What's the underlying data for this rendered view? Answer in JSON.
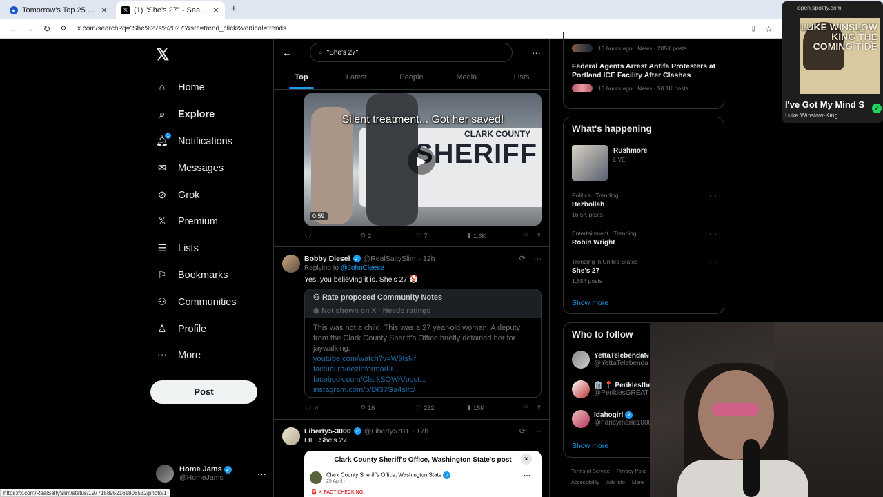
{
  "browser": {
    "tabs": [
      {
        "title": "Tomorrow's Top 25 Today proje",
        "active": false
      },
      {
        "title": "(1) \"She's 27\" - Search / X",
        "active": true
      }
    ],
    "url": "x.com/search?q=\"She%27s%2027\"&src=trend_click&vertical=trends",
    "status_url": "https://x.com/RealSaltySlim/status/1977158952161808532/photo/1"
  },
  "nav": {
    "items": [
      "Home",
      "Explore",
      "Notifications",
      "Messages",
      "Grok",
      "Premium",
      "Lists",
      "Bookmarks",
      "Communities",
      "Profile",
      "More"
    ],
    "notifications_badge": "1",
    "post_label": "Post",
    "account": {
      "name": "Home Jams",
      "handle": "@HomeJams"
    }
  },
  "search": {
    "query": "\"She's 27\"",
    "tabs": [
      "Top",
      "Latest",
      "People",
      "Media",
      "Lists"
    ]
  },
  "video": {
    "caption": "Silent treatment... Got her saved!",
    "sheriff_text": "SHERIFF",
    "county_text": "CLARK COUNTY",
    "duration": "0:59"
  },
  "tweet0_actions": {
    "replies": "",
    "reposts": "2",
    "likes": "7",
    "views": "1.6K"
  },
  "tweet1": {
    "name": "Bobby Diesel",
    "handle": "@RealSaltySlim",
    "time": "· 12h",
    "replying_label": "Replying to ",
    "replying_to": "@JohnCleese",
    "text": "Yes, you believing it is. She's 27 🤡",
    "note": {
      "title": "Rate proposed Community Notes",
      "subtitle": "Not shown on X · Needs ratings",
      "body": "This was not a child. This was a 27 year-old woman. A deputy from the Clark County Sheriff's Office briefly detained her for jaywalking:",
      "links": [
        "youtube.com/watch?v=W9tsNf...",
        "factual.ro/dezinformari-r...",
        "facebook.com/ClarkSOWA/post...",
        "instagram.com/p/DI37Ga4slfc/"
      ]
    },
    "actions": {
      "replies": "4",
      "reposts": "16",
      "likes": "232",
      "views": "15K"
    }
  },
  "tweet2": {
    "name": "Liberty5-3000",
    "handle": "@Liberty5781",
    "time": "· 17h",
    "text": "LIE.  She's 27.",
    "card_title": "Clark County Sheriff's Office, Washington State's post",
    "card_page": "Clark County Sheriff's Office, Washington State",
    "card_date": "25 April · ",
    "card_fact": "FACT CHECKING:"
  },
  "right": {
    "top_items": [
      {
        "meta": "13 hours ago · News · 205K posts"
      },
      {
        "title": "Federal Agents Arrest Antifa Protesters at Portland ICE Facility After Clashes",
        "meta": "13 hours ago · News · 50.1K posts"
      }
    ],
    "happening_title": "What's happening",
    "live": {
      "title": "Rushmore",
      "status": "LIVE"
    },
    "trends": [
      {
        "category": "Politics · Trending",
        "title": "Hezbollah",
        "count": "16.5K posts"
      },
      {
        "category": "Entertainment · Trending",
        "title": "Robin Wright",
        "count": ""
      },
      {
        "category": "Trending in United States",
        "title": "She's 27",
        "count": "1,654 posts"
      }
    ],
    "show_more": "Show more",
    "who_title": "Who to follow",
    "who": [
      {
        "name": "YettaTelebendaN",
        "handle": "@YettaTelebenda"
      },
      {
        "name": "🏛️ 📍 Periklesthe",
        "handle": "@PeriklesGREAT"
      },
      {
        "name": "Idahogirl",
        "handle": "@nancymarie1000"
      }
    ],
    "footer": [
      "Terms of Service",
      "Privacy Polic",
      "Accessibility",
      "Ads info",
      "More"
    ]
  },
  "spotify": {
    "source": "open.spotify.com",
    "cover_text": "LUKE WINSLOW KING THE COMING TIDE",
    "song": "I've Got My Mind S",
    "artist": "Luke Winslow-King"
  },
  "colors": {
    "accent": "#1d9bf0",
    "bg": "#000000",
    "border": "#2f3336",
    "muted": "#71767b"
  }
}
